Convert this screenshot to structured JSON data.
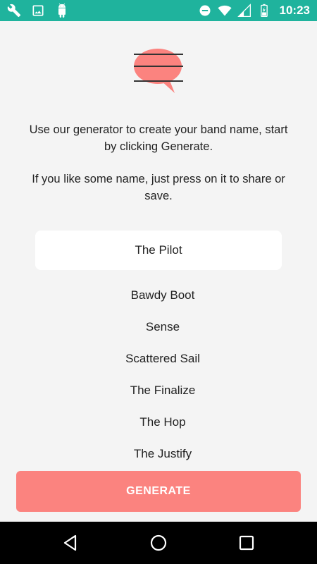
{
  "status_bar": {
    "time": "10:23",
    "left_icons": [
      "wrench-icon",
      "image-icon",
      "android-icon"
    ],
    "right_icons": [
      "do-not-disturb-icon",
      "wifi-icon",
      "signal-icon",
      "battery-charging-icon"
    ],
    "background": "#1fb39d"
  },
  "logo": {
    "icon": "speech-bubble-lines-icon",
    "color": "#fb837f"
  },
  "intro": {
    "line1": "Use our generator to create your band name, start by clicking Generate.",
    "line2": "If you like some name, just press on it to share or save."
  },
  "featured_name": "The Pilot",
  "names": [
    "Bawdy Boot",
    "Sense",
    "Scattered Sail",
    "The Finalize",
    "The Hop",
    "The Justify"
  ],
  "generate_button": {
    "label": "GENERATE",
    "color": "#fb837f"
  },
  "nav_bar": {
    "buttons": [
      "back-icon",
      "home-icon",
      "recents-icon"
    ]
  }
}
